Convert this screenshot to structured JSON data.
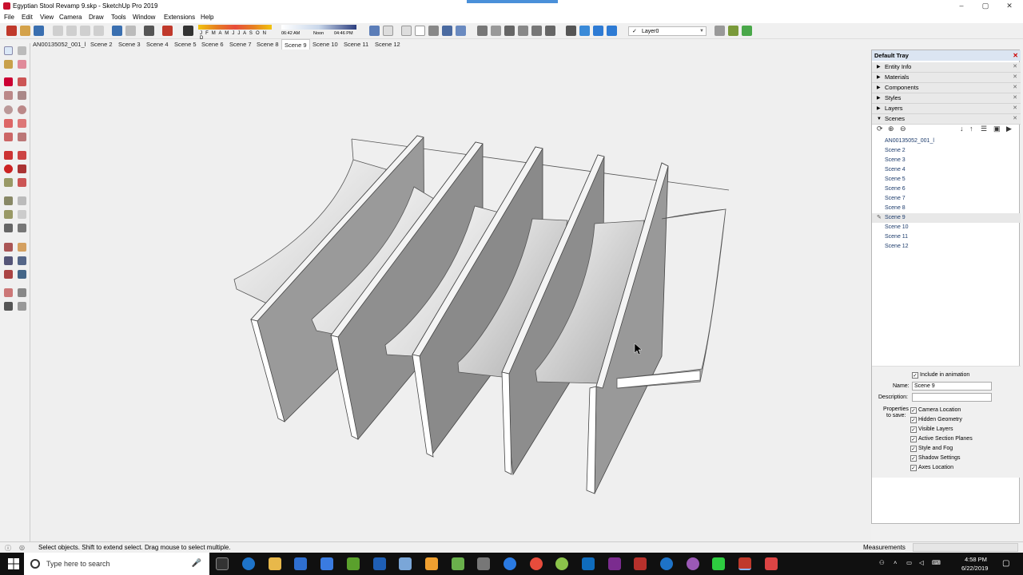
{
  "window": {
    "title": "Egyptian Stool Revamp 9.skp - SketchUp Pro 2019",
    "minimize": "–",
    "maximize": "▢",
    "close": "✕"
  },
  "menu": [
    "File",
    "Edit",
    "View",
    "Camera",
    "Draw",
    "Tools",
    "Window",
    "Extensions",
    "Help"
  ],
  "toolbar": {
    "months": "J F M A M J J A S O N D",
    "time_start": "06:42 AM",
    "time_mid": "Noon",
    "time_end": "04:46 PM",
    "layer": "Layer0"
  },
  "scene_tabs": [
    "AN00135052_001_l",
    "Scene 2",
    "Scene 3",
    "Scene 4",
    "Scene 5",
    "Scene 6",
    "Scene 7",
    "Scene 8",
    "Scene 9",
    "Scene 10",
    "Scene 11",
    "Scene 12"
  ],
  "active_scene_tab": "Scene 9",
  "tray": {
    "title": "Default Tray",
    "panels": [
      "Entity Info",
      "Materials",
      "Components",
      "Styles",
      "Layers",
      "Scenes"
    ],
    "scenes": [
      "AN00135052_001_l",
      "Scene 2",
      "Scene 3",
      "Scene 4",
      "Scene 5",
      "Scene 6",
      "Scene 7",
      "Scene 8",
      "Scene 9",
      "Scene 10",
      "Scene 11",
      "Scene 12"
    ],
    "selected_scene": "Scene 9",
    "include_in_animation": "Include in animation",
    "name_label": "Name:",
    "name_value": "Scene 9",
    "description_label": "Description:",
    "description_value": "",
    "properties_label_1": "Properties",
    "properties_label_2": "to save:",
    "properties": [
      "Camera Location",
      "Hidden Geometry",
      "Visible Layers",
      "Active Section Planes",
      "Style and Fog",
      "Shadow Settings",
      "Axes Location"
    ]
  },
  "status": {
    "message": "Select objects. Shift to extend select. Drag mouse to select multiple.",
    "measurements_label": "Measurements"
  },
  "taskbar": {
    "search_placeholder": "Type here to search",
    "time": "4:58 PM",
    "date": "6/22/2019"
  },
  "colors": {
    "tray_header": "#dbe5f2",
    "viewport": "#efefef",
    "taskbar": "#101010"
  }
}
